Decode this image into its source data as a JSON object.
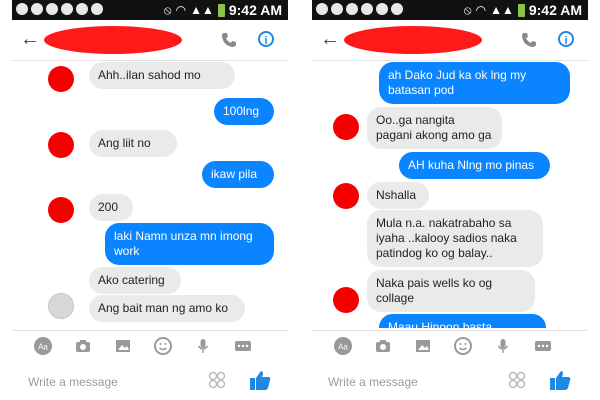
{
  "status_bar": {
    "time": "9:42 AM",
    "signal": "▲▲",
    "mute": "⦸",
    "wifi": "◠"
  },
  "header": {
    "back_glyph": "←",
    "info_glyph": "i"
  },
  "composer": {
    "placeholder": "Write a message",
    "aa_label": "Aa"
  },
  "colors": {
    "accent": "#0a84ff",
    "incoming": "#eaeaea",
    "redaction": "#ff1a1a"
  },
  "left_chat": {
    "m1": "Ahh..ilan sahod mo",
    "m2": "100lng",
    "m3": "Ang liit no",
    "m4": "ikaw pila",
    "m5": "200",
    "m6": "laki Namn unza mn imong work",
    "m7": "Ako catering",
    "m8": "Ang bait man ng amo ko"
  },
  "right_chat": {
    "m1": "ah Dako Jud ka ok lng my batasan pod",
    "m2": "Oo..ga nangita pagani akong amo ga",
    "m3": "AH kuha Nlng mo pinas",
    "m4": "Nshalla",
    "m5": "Mula n.a. nakatrabaho sa iyaha ..kalooy sadios naka patindog ko og balay..",
    "m6": "Naka pais wells ko og collage",
    "m7": "Maau Hinoon basta"
  }
}
